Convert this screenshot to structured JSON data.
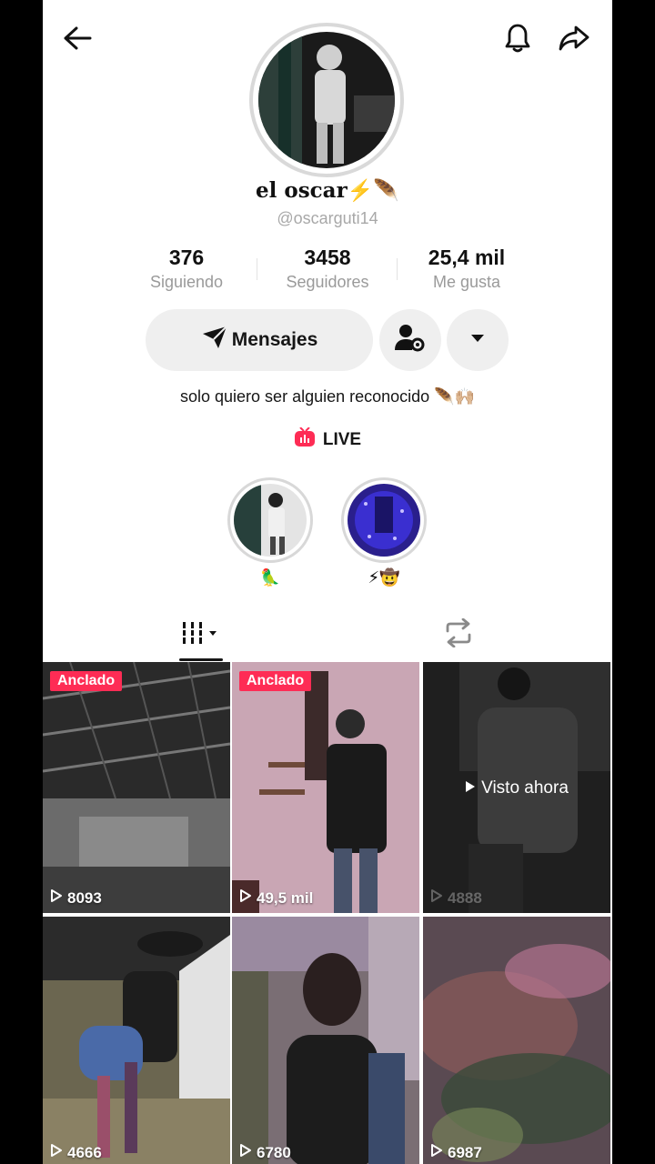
{
  "profile": {
    "nickname": "el oscar",
    "nickname_emoji": "⚡🪶",
    "handle": "@oscarguti14",
    "bio": "solo quiero ser alguien reconocido 🪶🙌🏼",
    "live_label": "LIVE"
  },
  "stats": [
    {
      "value": "376",
      "label": "Siguiendo"
    },
    {
      "value": "3458",
      "label": "Seguidores"
    },
    {
      "value": "25,4 mil",
      "label": "Me gusta"
    }
  ],
  "actions": {
    "message_label": "Mensajes"
  },
  "highlights": [
    {
      "label": "🦜"
    },
    {
      "label": "⚡🤠"
    }
  ],
  "icons": {
    "back": "back-arrow-icon",
    "bell": "bell-icon",
    "share": "share-icon",
    "grid": "grid-icon",
    "repost": "repost-icon"
  },
  "videos": [
    {
      "pinned": "Anclado",
      "views": "8093"
    },
    {
      "pinned": "Anclado",
      "views": "49,5 mil"
    },
    {
      "watched": "Visto ahora",
      "views": "4888"
    },
    {
      "views": "4666"
    },
    {
      "views": "6780"
    },
    {
      "views": "6987"
    }
  ],
  "colors": {
    "accent": "#fe2c55",
    "button_bg": "#efefef",
    "muted_text": "#9a9a9a"
  }
}
